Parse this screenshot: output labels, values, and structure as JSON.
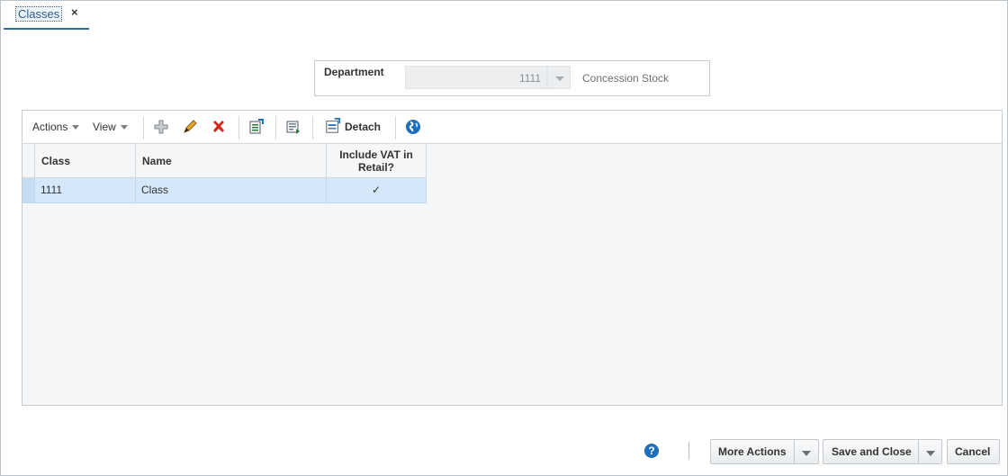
{
  "tab": {
    "label": "Classes",
    "close": "×"
  },
  "department": {
    "label": "Department",
    "value": "1111",
    "description": "Concession Stock"
  },
  "toolbar": {
    "actions_label": "Actions",
    "view_label": "View",
    "detach_label": "Detach"
  },
  "table": {
    "columns": {
      "class": "Class",
      "name": "Name",
      "vat_line1": "Include VAT in",
      "vat_line2": "Retail?"
    },
    "rows": [
      {
        "class": "1111",
        "name": "Class",
        "vat": "✓"
      }
    ]
  },
  "footer": {
    "help": "?",
    "more_actions": "More Actions",
    "save_close": "Save and Close",
    "cancel": "Cancel"
  },
  "colors": {
    "accent": "#2f6dad",
    "selected_row": "#d4e8fa",
    "delete_red": "#d22b1c"
  }
}
